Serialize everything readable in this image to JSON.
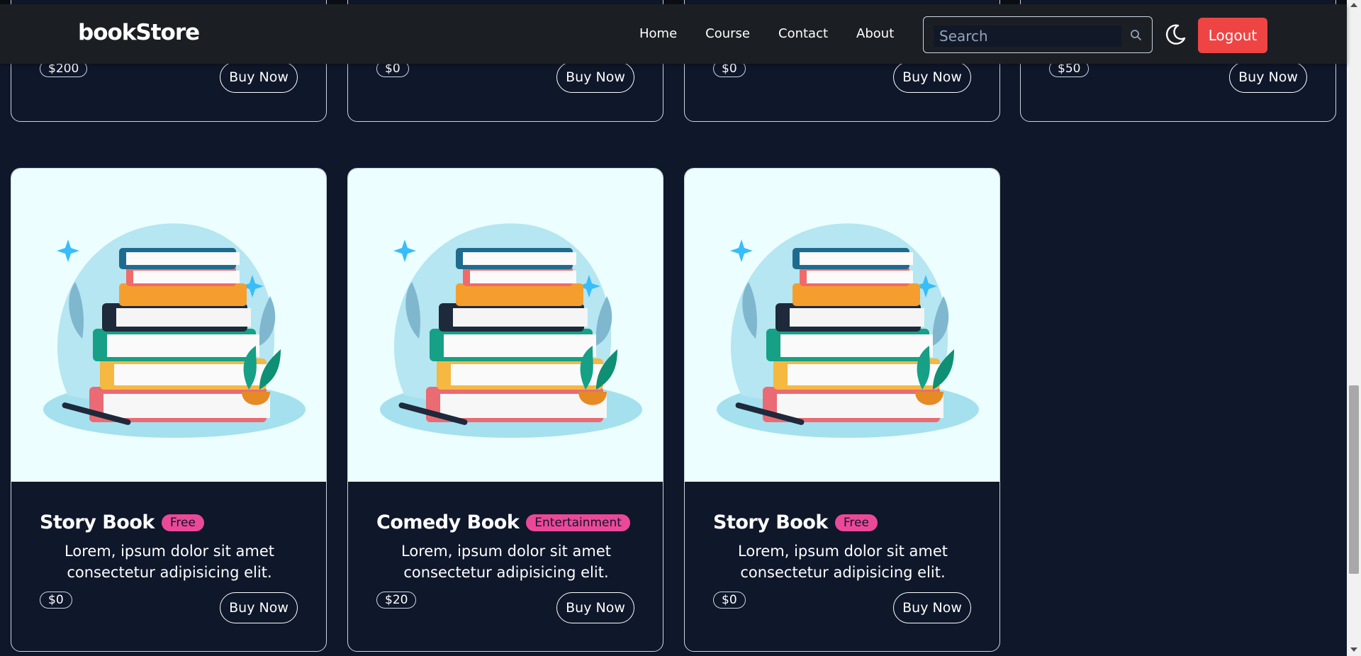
{
  "navbar": {
    "brand": "bookStore",
    "links": [
      "Home",
      "Course",
      "Contact",
      "About"
    ],
    "search_placeholder": "Search",
    "theme_icon": "moon-icon",
    "logout_label": "Logout"
  },
  "colors": {
    "background": "#0f172a",
    "navbar": "#1b1f24",
    "badge": "#ec4899",
    "logout": "#ef4444",
    "card_image_bg": "#ecfeff"
  },
  "top_cards": [
    {
      "price": "$200",
      "button": "Buy Now"
    },
    {
      "price": "$0",
      "button": "Buy Now"
    },
    {
      "price": "$0",
      "button": "Buy Now"
    },
    {
      "price": "$50",
      "button": "Buy Now"
    }
  ],
  "cards": [
    {
      "title": "Story Book",
      "badge": "Free",
      "description": "Lorem, ipsum dolor sit amet consectetur adipisicing elit.",
      "price": "$0",
      "button": "Buy Now"
    },
    {
      "title": "Comedy Book",
      "badge": "Entertainment",
      "description": "Lorem, ipsum dolor sit amet consectetur adipisicing elit.",
      "price": "$20",
      "button": "Buy Now"
    },
    {
      "title": "Story Book",
      "badge": "Free",
      "description": "Lorem, ipsum dolor sit amet consectetur adipisicing elit.",
      "price": "$0",
      "button": "Buy Now"
    }
  ]
}
